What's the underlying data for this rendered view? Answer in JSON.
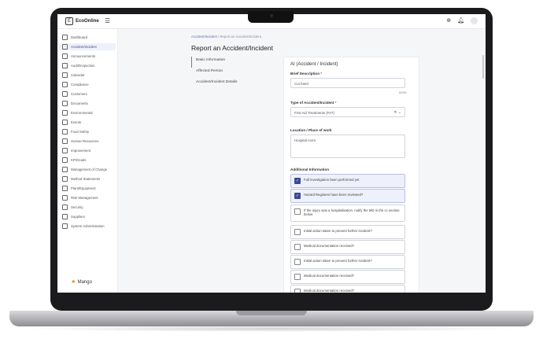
{
  "topbar": {
    "logo": "EcoOnline",
    "logo_mark": "E",
    "menu_icon": "menu-icon",
    "icons": [
      "add-icon",
      "bell-icon",
      "user-avatar-icon"
    ]
  },
  "sidebar": {
    "items": [
      {
        "label": "Dashboard",
        "icon": "dashboard-icon"
      },
      {
        "label": "Accident/Incident",
        "icon": "alert-icon",
        "active": true
      },
      {
        "label": "Announcements",
        "icon": "megaphone-icon"
      },
      {
        "label": "Audit/Inspection",
        "icon": "clipboard-icon"
      },
      {
        "label": "Calendar",
        "icon": "calendar-icon"
      },
      {
        "label": "Compliance",
        "icon": "compliance-icon"
      },
      {
        "label": "Customers",
        "icon": "cart-icon"
      },
      {
        "label": "Documents",
        "icon": "folder-icon"
      },
      {
        "label": "Environmental",
        "icon": "globe-icon"
      },
      {
        "label": "Events",
        "icon": "events-icon"
      },
      {
        "label": "Food Safety",
        "icon": "food-icon"
      },
      {
        "label": "Human Resources",
        "icon": "people-icon"
      },
      {
        "label": "Improvement",
        "icon": "chart-icon"
      },
      {
        "label": "KPI/Goals",
        "icon": "goals-icon"
      },
      {
        "label": "Management of Change",
        "icon": "change-icon"
      },
      {
        "label": "Method Statements",
        "icon": "method-icon"
      },
      {
        "label": "Plant/Equipment",
        "icon": "equipment-icon"
      },
      {
        "label": "Risk Management",
        "icon": "risk-icon"
      },
      {
        "label": "Security",
        "icon": "lock-icon"
      },
      {
        "label": "Suppliers",
        "icon": "truck-icon"
      },
      {
        "label": "System Administration",
        "icon": "gear-icon"
      }
    ],
    "brand": "Mango"
  },
  "main": {
    "breadcrumb_link": "Accident/Incident",
    "breadcrumb_rest": " / Report an Accident/Incident",
    "title": "Report an Accident/Incident",
    "steps": [
      "Basic Information",
      "Affected Person",
      "Accident/Incident Details"
    ]
  },
  "form": {
    "title": "AI (Accident / Incident)",
    "brief_label": "Brief Description",
    "brief_value": "Cut hand",
    "brief_count": "8/256",
    "type_label": "Type of Accident/Incident",
    "type_value": "First Aid Treatments (FAT)",
    "location_label": "Location / Place of work",
    "location_value": "Hospital room",
    "additional_label": "Additional Information",
    "required_mark": "*",
    "checks": [
      {
        "label": "Full investigation been performed yet",
        "checked": true
      },
      {
        "label": "Hazard Registers have been reviewed?",
        "checked": true
      },
      {
        "label": "If the injury was a hospitalisation, notify the MD in the cc section below",
        "checked": false
      },
      {
        "label": "Initial action taken to prevent further incident?",
        "checked": false
      },
      {
        "label": "Medical documentation received?",
        "checked": false
      },
      {
        "label": "Initial action taken to prevent further incident?",
        "checked": false
      },
      {
        "label": "Medical documentation received?",
        "checked": false
      },
      {
        "label": "Medical documentation received?",
        "checked": false
      }
    ]
  },
  "colors": {
    "accent": "#3b4a8f",
    "active_step": "#3aa34a",
    "required": "#d33333"
  }
}
